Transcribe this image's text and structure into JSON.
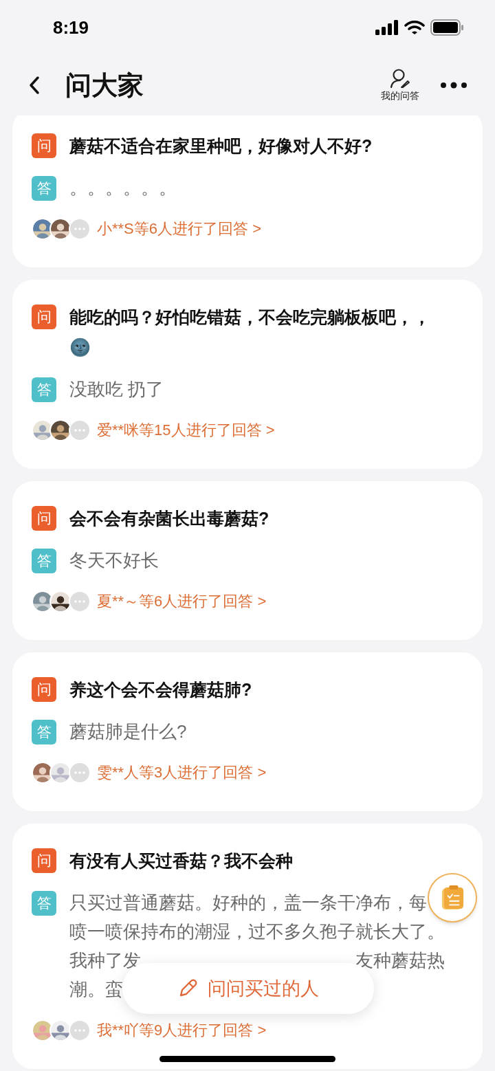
{
  "status_bar": {
    "time": "8:19"
  },
  "header": {
    "title": "问大家",
    "my_answers_label": "我的问答"
  },
  "cards": [
    {
      "question_badge": "问",
      "question": "蘑菇不适合在家里种吧，好像对人不好?",
      "answer_badge": "答",
      "answer_lines": [
        "。。。。。。"
      ],
      "answerers": "小**S等6人进行了回答 >"
    },
    {
      "question_badge": "问",
      "question": "能吃的吗？好怕吃错菇，不会吃完躺板板吧，，🌚",
      "answer_badge": "答",
      "answer_lines": [
        "没敢吃 扔了"
      ],
      "answerers": "爱**咪等15人进行了回答 >"
    },
    {
      "question_badge": "问",
      "question": "会不会有杂菌长出毒蘑菇?",
      "answer_badge": "答",
      "answer_lines": [
        "冬天不好长"
      ],
      "answerers": "夏**～等6人进行了回答 >"
    },
    {
      "question_badge": "问",
      "question": "养这个会不会得蘑菇肺?",
      "answer_badge": "答",
      "answer_lines": [
        "蘑菇肺是什么?"
      ],
      "answerers": "雯**人等3人进行了回答 >"
    },
    {
      "question_badge": "问",
      "question": "有没有人买过香菇？我不会种",
      "answer_badge": "答",
      "answer_lines": [
        "只买过普通蘑菇。好种的，盖一条干净布，每",
        "喷一喷保持布的潮湿，过不多久孢子就长大了。",
        [
          "我种了发",
          "友种蘑菇热"
        ],
        "潮。蛮"
      ],
      "answerers": "我**吖等9人进行了回答 >"
    }
  ],
  "ask_button": {
    "label": "问问买过的人"
  }
}
